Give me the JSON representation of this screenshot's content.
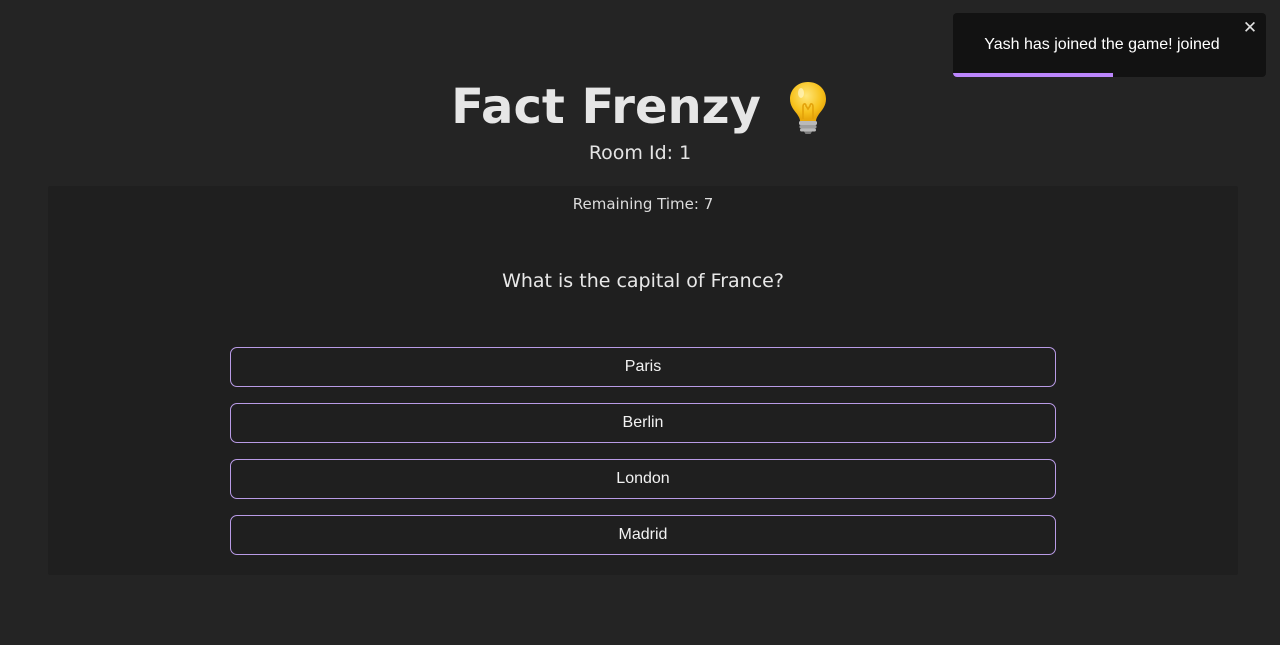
{
  "header": {
    "title": "Fact Frenzy",
    "room_label": "Room Id: 1"
  },
  "quiz": {
    "remaining_time_label": "Remaining Time: 7",
    "question": "What is the capital of France?",
    "options": [
      "Paris",
      "Berlin",
      "London",
      "Madrid"
    ]
  },
  "toast": {
    "message": "Yash has joined the game! joined",
    "close_glyph": "✕",
    "progress": 0.51
  },
  "colors": {
    "background": "#242424",
    "card": "#1f1f1f",
    "option_border": "#b99be6",
    "toast_bg": "#121212",
    "accent": "#bb86fc"
  },
  "icons": {
    "title_icon": "lightbulb-icon",
    "toast_close": "close-icon"
  }
}
